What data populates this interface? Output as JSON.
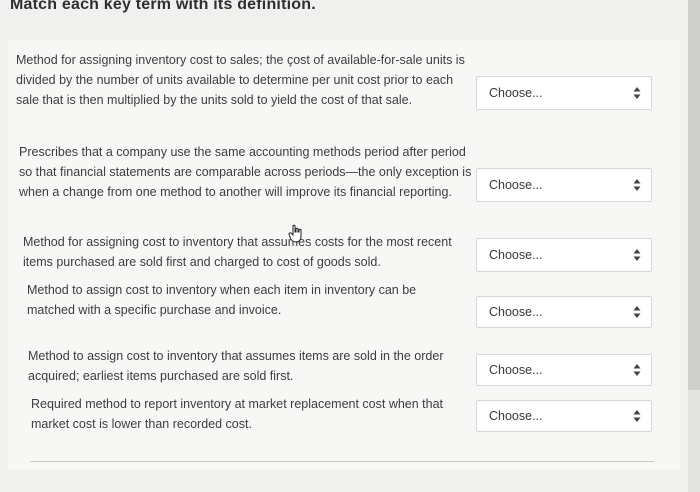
{
  "page": {
    "title": "Match each key term with its definition."
  },
  "questions": [
    {
      "definition": "Method for assigning inventory cost to sales; the çost of available-for-sale units is divided by the number of units available to determine per unit cost prior to each sale that is then multiplied by the units sold to yield the cost of that sale.",
      "select_label": "Choose..."
    },
    {
      "definition": "Prescribes that a company use the same accounting methods period after period so that financial statements are comparable across periods—the only exception is when a change from one method to another will improve its financial reporting.",
      "select_label": "Choose..."
    },
    {
      "definition": "Method for assigning cost to inventory that assumes costs for the most recent items purchased are sold first and charged to cost of goods sold.",
      "select_label": "Choose..."
    },
    {
      "definition": "Method to assign cost to inventory when each item in inventory can be matched with a specific purchase and invoice.",
      "select_label": "Choose..."
    },
    {
      "definition": "Method to assign cost to inventory that assumes items are sold in the order acquired; earliest items purchased are sold first.",
      "select_label": "Choose..."
    },
    {
      "definition": "Required method to report inventory at market replacement cost when that market cost is lower than recorded cost.",
      "select_label": "Choose..."
    }
  ],
  "icons": {
    "select_arrow": "updown-icon",
    "cursor": "hand-cursor-icon"
  },
  "colors": {
    "background": "#f0f0ee",
    "panel": "#f7f7f5",
    "select_border": "#d8d8d8",
    "text": "#3d3d3d"
  }
}
